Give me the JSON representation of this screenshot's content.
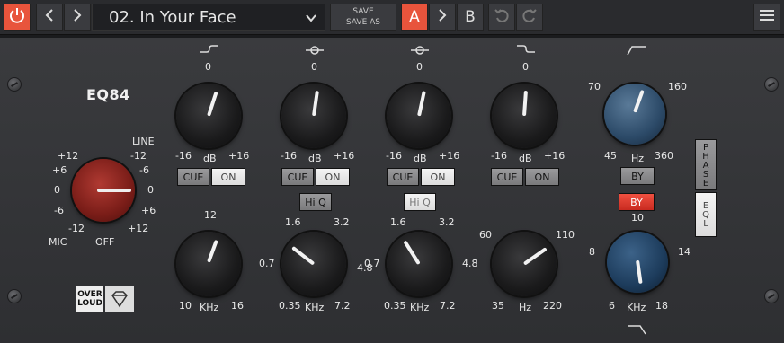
{
  "topbar": {
    "power_icon": "power-icon",
    "prev_icon": "chevron-left-icon",
    "next_icon": "chevron-right-icon",
    "preset_name": "02. In Your Face",
    "preset_dropdown_icon": "chevron-down-icon",
    "save_label": "SAVE",
    "save_as_label": "SAVE AS",
    "ab_a": "A",
    "ab_b": "B",
    "ab_copy_icon": "chevron-right-icon",
    "undo_icon": "undo-icon",
    "redo_icon": "redo-icon",
    "menu_icon": "hamburger-menu-icon",
    "colors": {
      "accent": "#e8543c",
      "bar": "#2a2b2e"
    }
  },
  "plugin": {
    "title": "EQ84",
    "input": {
      "left_labels": [
        "+12",
        "+6",
        "0",
        "-6",
        "-12"
      ],
      "right_labels": [
        "-12",
        "-6",
        "0",
        "+6",
        "+12"
      ],
      "line": "LINE",
      "mic": "MIC",
      "off": "OFF"
    },
    "bands": [
      {
        "gain_zero": "0",
        "gain_min": "-16",
        "gain_unit": "dB",
        "gain_max": "+16",
        "cue": "CUE",
        "on": "ON",
        "on_active": true,
        "freq_top": "12",
        "freq_left": "10",
        "freq_unit": "KHz",
        "freq_right": "16",
        "icon": "high-shelf-icon"
      },
      {
        "gain_zero": "0",
        "gain_min": "-16",
        "gain_unit": "dB",
        "gain_max": "+16",
        "cue": "CUE",
        "on": "ON",
        "on_active": true,
        "hiq": "Hi Q",
        "hiq_active": false,
        "freq_labels": [
          "1.6",
          "3.2",
          "0.7",
          "4.8",
          "0.35",
          "KHz",
          "7.2"
        ],
        "icon": "bell-icon"
      },
      {
        "gain_zero": "0",
        "gain_min": "-16",
        "gain_unit": "dB",
        "gain_max": "+16",
        "cue": "CUE",
        "on": "ON",
        "on_active": true,
        "hiq": "Hi Q",
        "hiq_active": true,
        "freq_labels": [
          "1.6",
          "3.2",
          "0.7",
          "4.8",
          "0.35",
          "KHz",
          "7.2"
        ],
        "icon": "bell-icon"
      },
      {
        "gain_zero": "0",
        "gain_min": "-16",
        "gain_unit": "dB",
        "gain_max": "+16",
        "cue": "CUE",
        "on": "ON",
        "on_active": false,
        "freq_labels": [
          "60",
          "110",
          "35",
          "Hz",
          "220"
        ],
        "icon": "low-shelf-icon"
      }
    ],
    "hp": {
      "labels": [
        "70",
        "160",
        "45",
        "Hz",
        "360"
      ],
      "by": "BY",
      "icon": "highpass-icon"
    },
    "lp": {
      "labels": [
        "10",
        "8",
        "14",
        "6",
        "KHz",
        "18"
      ],
      "by": "BY",
      "by_active": true,
      "icon": "lowpass-icon"
    },
    "phase_label": "PHASE",
    "eql_label": "EQL",
    "logo_text": "OVER LOUD",
    "logo_icon": "diamond-icon"
  }
}
